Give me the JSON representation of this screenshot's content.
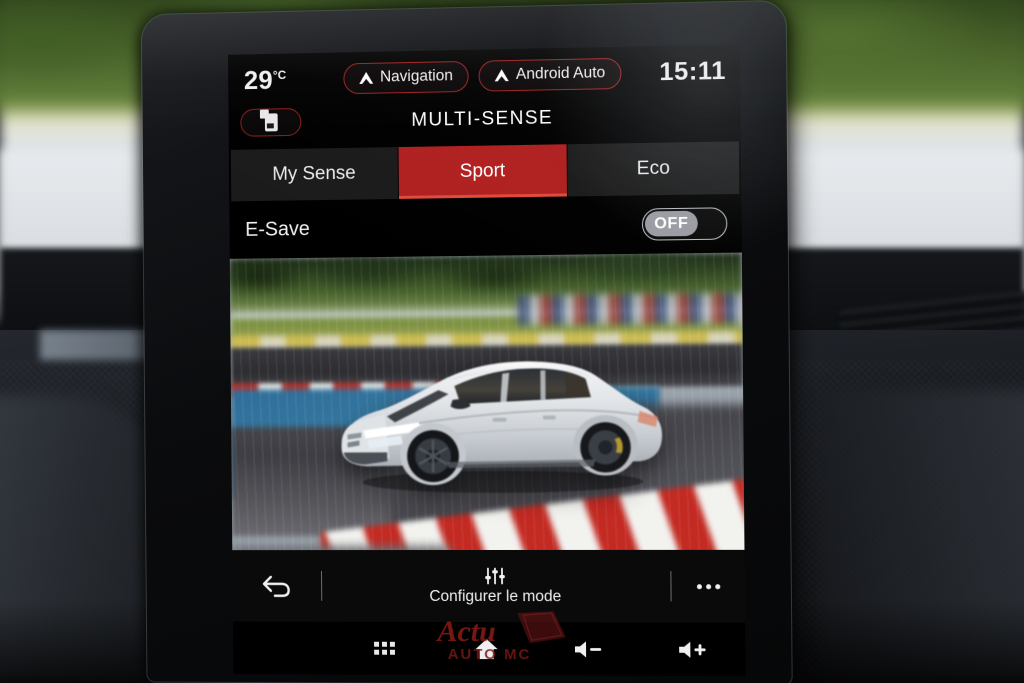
{
  "status_bar": {
    "temperature": "29",
    "temperature_unit": "°C",
    "clock": "15:11",
    "pills": [
      {
        "label": "Navigation",
        "icon": "navigation-arrow-icon"
      },
      {
        "label": "Android Auto",
        "icon": "navigation-arrow-icon"
      }
    ]
  },
  "header": {
    "title": "MULTI-SENSE",
    "phone_pill_icon": "phone-connect-icon"
  },
  "tabs": [
    {
      "label": "My Sense",
      "active": false
    },
    {
      "label": "Sport",
      "active": true
    },
    {
      "label": "Eco",
      "active": false
    }
  ],
  "settings": {
    "esave_label": "E-Save",
    "esave_state": "OFF"
  },
  "hero": {
    "alt": "Renault Clio on race track, motion blurred"
  },
  "bottom_bar": {
    "back_icon": "back-arrow-icon",
    "configure_label": "Configurer le mode",
    "configure_icon": "sliders-icon",
    "more_icon": "more-dots-icon"
  },
  "nav_bar": {
    "apps_icon": "apps-grid-icon",
    "home_icon": "home-icon",
    "volume_down_icon": "volume-down-icon",
    "volume_up_icon": "volume-up-icon"
  },
  "watermark": {
    "line1": "Actu",
    "line2": "AUTO MC"
  },
  "colors": {
    "accent_red": "#b02020",
    "pill_border_red": "#9e2120",
    "screen_black": "#000000",
    "text_white": "#f0f0f0",
    "tab_inactive": "#1b1b1b"
  }
}
